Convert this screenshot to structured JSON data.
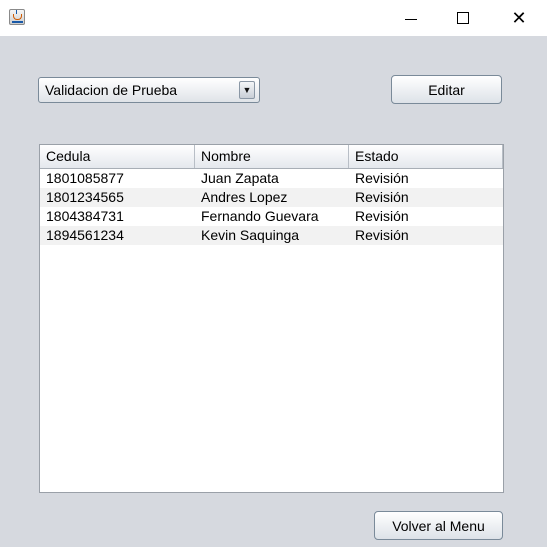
{
  "window": {
    "icon": "java-cup-icon",
    "controls": {
      "minimize": "minimize-icon",
      "maximize": "maximize-icon",
      "close": "✕"
    }
  },
  "form": {
    "combo_selected": "Validacion de Prueba",
    "combo_arrow": "▼",
    "edit_label": "Editar",
    "back_label": "Volver al Menu"
  },
  "table": {
    "columns": [
      "Cedula",
      "Nombre",
      "Estado"
    ],
    "rows": [
      [
        "1801085877",
        "Juan Zapata",
        "Revisión"
      ],
      [
        "1801234565",
        "Andres Lopez",
        "Revisión"
      ],
      [
        "1804384731",
        "Fernando Guevara",
        "Revisión"
      ],
      [
        "1894561234",
        "Kevin Saquinga",
        "Revisión"
      ]
    ]
  }
}
